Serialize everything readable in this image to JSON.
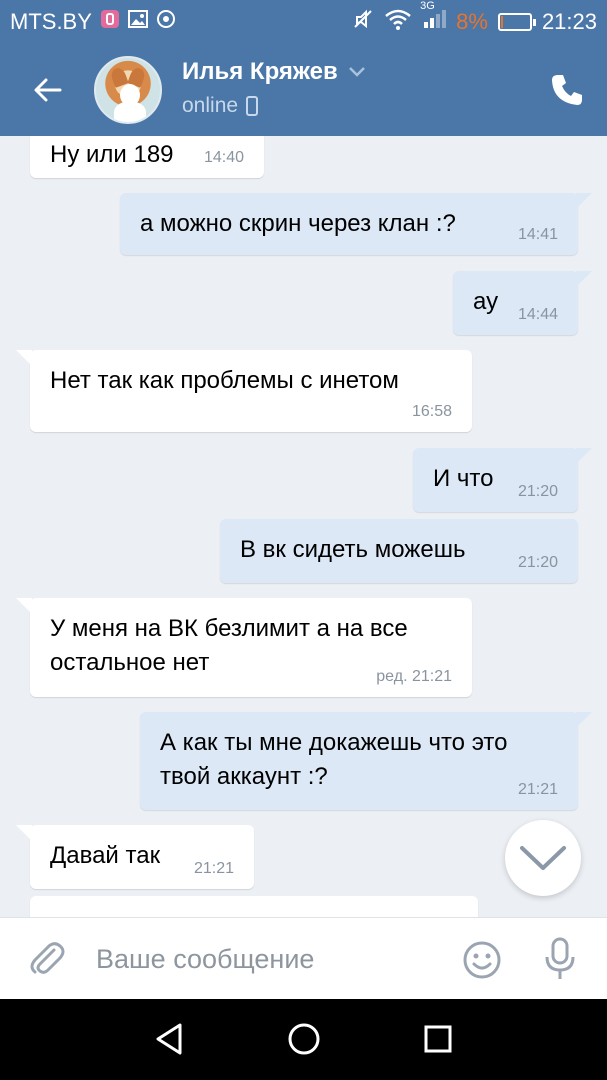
{
  "status_bar": {
    "carrier": "MTS.BY",
    "network": "3G",
    "battery": "8%",
    "battery_level": 0.08,
    "time": "21:23",
    "accent_color": "#e8732c"
  },
  "header": {
    "contact_name": "Илья Кряжев",
    "contact_status": "online",
    "bg_color": "#4a76a8"
  },
  "messages": [
    {
      "direction": "in",
      "text": "Ну или 189",
      "time": "14:40"
    },
    {
      "direction": "out",
      "text": "а можно скрин через клан :?",
      "time": "14:41"
    },
    {
      "direction": "out",
      "text": "ау",
      "time": "14:44"
    },
    {
      "direction": "in",
      "text": "Нет так как проблемы с инетом",
      "time": "16:58"
    },
    {
      "direction": "out",
      "text": "И что",
      "time": "21:20"
    },
    {
      "direction": "out",
      "text": "В вк сидеть можешь",
      "time": "21:20"
    },
    {
      "direction": "in",
      "text": "У меня на ВК безлимит а на все остальное нет",
      "time": "ред. 21:21"
    },
    {
      "direction": "out",
      "text": "А как ты мне докажешь что это твой аккаунт :?",
      "time": "21:21"
    },
    {
      "direction": "in",
      "text": "Давай так",
      "time": "21:21"
    }
  ],
  "composer": {
    "placeholder": "Ваше сообщение",
    "value": ""
  },
  "icons": {
    "back": "arrow-left-icon",
    "phone": "phone-icon",
    "attach": "paperclip-icon",
    "emoji": "smiley-icon",
    "mic": "microphone-icon",
    "scroll_down": "chevron-down-icon",
    "nav_back": "triangle-back-icon",
    "nav_home": "circle-home-icon",
    "nav_recents": "square-recents-icon"
  }
}
